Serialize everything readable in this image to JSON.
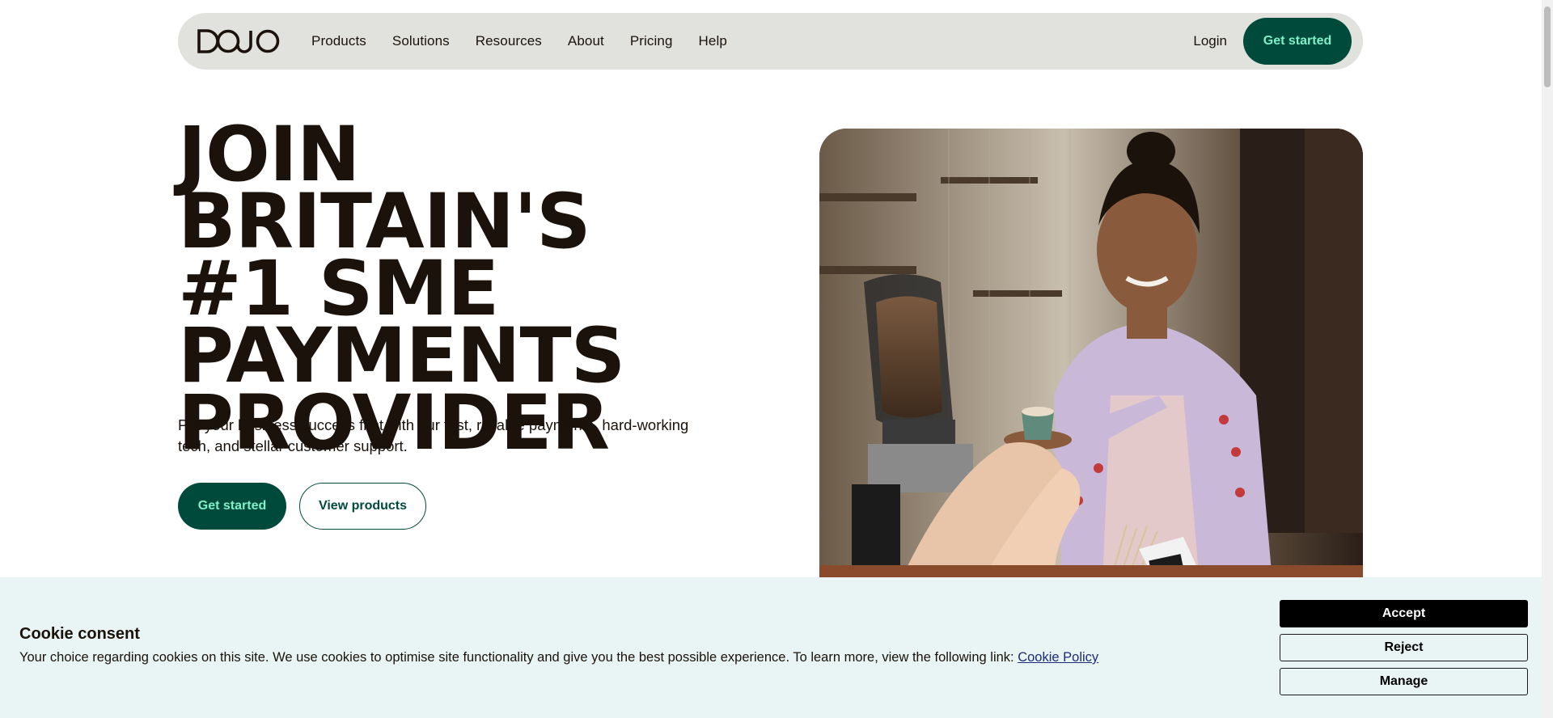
{
  "brand": {
    "logo_text": "DOJO",
    "accent": "#004a3b",
    "accent_text": "#7ff0c8"
  },
  "nav": {
    "links": [
      "Products",
      "Solutions",
      "Resources",
      "About",
      "Pricing",
      "Help"
    ],
    "login": "Login",
    "cta": "Get started"
  },
  "hero": {
    "title_lines": [
      "JOIN BRITAIN'S",
      "#1 SME",
      "PAYMENTS",
      "PROVIDER"
    ],
    "subtitle": "Put your business success first with our fast, reliable payments, hard-working tech, and stellar customer support.",
    "primary_cta": "Get started",
    "secondary_cta": "View products"
  },
  "cookie": {
    "title": "Cookie consent",
    "text": "Your choice regarding cookies on this site. We use cookies to optimise site functionality and give you the best possible experience. To learn more, view the following link:",
    "link": "Cookie Policy",
    "accept": "Accept",
    "reject": "Reject",
    "manage": "Manage"
  }
}
